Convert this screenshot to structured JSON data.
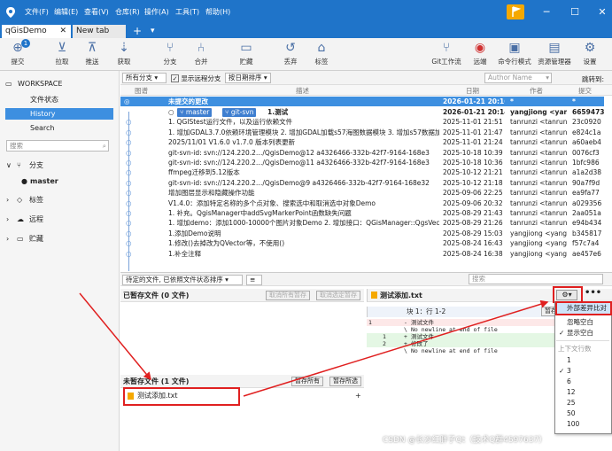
{
  "app": {
    "menus": [
      "文件(F)",
      "编辑(E)",
      "查看(V)",
      "仓库(R)",
      "操作(A)",
      "工具(T)",
      "帮助(H)"
    ],
    "tabs": [
      "qGisDemo",
      "New tab"
    ]
  },
  "toolbar": {
    "items": [
      "提交",
      "拉取",
      "推送",
      "获取",
      "分支",
      "合并",
      "贮藏",
      "丢弃",
      "标签",
      "Git工作流",
      "远端",
      "命令行模式",
      "资源管理器",
      "设置"
    ],
    "commit_badge": "1"
  },
  "sidebar": {
    "workspace": "WORKSPACE",
    "file_status": "文件状态",
    "history": "History",
    "search": "Search",
    "search_placeholder": "搜索",
    "branches": "分支",
    "master": "master",
    "tags": "标签",
    "remotes": "远程",
    "stashes": "贮藏"
  },
  "filterbar": {
    "branch_filter": "所有分支",
    "show_remote": "显示远程分支",
    "sort": "按日期排序",
    "author_placeholder": "Author Name",
    "jump_label": "跳转到:"
  },
  "columns": [
    "图谱",
    "描述",
    "日期",
    "作者",
    "提交"
  ],
  "commits": [
    {
      "desc": "未提交的更改",
      "date": "2026-01-21 20:16",
      "author": "*",
      "hash": "*"
    },
    {
      "tags": [
        "master",
        "git-svn"
      ],
      "desc": "1.测试",
      "date": "2026-01-21 20:14",
      "author": "yangjiong <yang",
      "hash": "6659473"
    },
    {
      "desc": "1. QGIStest运行文件，以及运行依赖文件",
      "date": "2025-11-01 21:51",
      "author": "tanrunzi <tanrun",
      "hash": "23c0920"
    },
    {
      "desc": "1. 增加GDAL3.7.0依赖环境管理模块 2. 增加GDAL加载s57海图数据模块 3. 增加s57数据加",
      "date": "2025-11-01 21:47",
      "author": "tanrunzi <tanrun",
      "hash": "e824c1a"
    },
    {
      "desc": "2025/11/01 V1.6.0 v1.7.0 版本列表更新",
      "date": "2025-11-01 21:24",
      "author": "tanrunzi <tanrun",
      "hash": "a60aeb4"
    },
    {
      "desc": "git-svn-id: svn://124.220.2…/QgisDemo@12 a4326466-332b-42f7-9164-168e3",
      "date": "2025-10-18 10:39",
      "author": "tanrunzi <tanrun",
      "hash": "0076cf3"
    },
    {
      "desc": "git-svn-id: svn://124.220.2…/QgisDemo@11 a4326466-332b-42f7-9164-168e3",
      "date": "2025-10-18 10:36",
      "author": "tanrunzi <tanrun",
      "hash": "1bfc986"
    },
    {
      "desc": "ffmpeg迁移到5.12版本",
      "date": "2025-10-12 21:21",
      "author": "tanrunzi <tanrun",
      "hash": "a1a2d38"
    },
    {
      "desc": "git-svn-id: svn://124.220.2…/QgisDemo@9 a4326466-332b-42f7-9164-168e32",
      "date": "2025-10-12 21:18",
      "author": "tanrunzi <tanrun",
      "hash": "90a7f9d"
    },
    {
      "desc": "增加图层显示和隐藏操作功能",
      "date": "2025-09-06 22:25",
      "author": "tanrunzi <tanrun",
      "hash": "ea9fa77"
    },
    {
      "desc": "V1.4.0：添加特定名称的多个点对象、搜索选中和取消选中对象Demo",
      "date": "2025-09-06 20:32",
      "author": "tanrunzi <tanrun",
      "hash": "a029356"
    },
    {
      "desc": "1. 补充。QgisManager中addSvgMarkerPoint函数缺失问题",
      "date": "2025-08-29 21:43",
      "author": "tanrunzi <tanrun",
      "hash": "2aa051a"
    },
    {
      "desc": "1. 增加demo：添加1000-10000个图片对象Demo 2. 增加接口：QGisManager::QgsVec",
      "date": "2025-08-29 21:26",
      "author": "tanrunzi <tanrun",
      "hash": "e94b434"
    },
    {
      "desc": "1.添加Demo说明",
      "date": "2025-08-29 15:03",
      "author": "yangjiong <yang",
      "hash": "b345817"
    },
    {
      "desc": "1.修改()去掉改为QVector等，不使用()",
      "date": "2025-08-24 16:43",
      "author": "yangjiong <yang",
      "hash": "f57c7a4"
    },
    {
      "desc": "1.补全注释",
      "date": "2025-08-24 16:38",
      "author": "yangjiong <yang",
      "hash": "ae457e6"
    }
  ],
  "lower": {
    "file_sort": "待定的文件, 已依照文件状态排序",
    "search_placeholder": "搜索",
    "staged_title": "已暂存文件 (0 文件)",
    "unstage_all": "取消所有暂存",
    "unstage_selected": "取消选定暂存",
    "unstaged_title": "未暂存文件 (1 文件)",
    "stage_all": "暂存所有",
    "stage_selected": "暂存所选",
    "unstaged_file": "测试添加.txt",
    "diff_file": "测试添加.txt",
    "hunk_label": "块 1：行 1-2",
    "hunk_button": "暂存",
    "diff_lines": [
      {
        "old": "1",
        "new": "",
        "sign": "-",
        "text": "测试文件"
      },
      {
        "old": "",
        "new": "",
        "sign": "\\",
        "text": "No newline at end of file"
      },
      {
        "old": "",
        "new": "1",
        "sign": "+",
        "text": "测试文件"
      },
      {
        "old": "",
        "new": "2",
        "sign": "+",
        "text": "修改了"
      },
      {
        "old": "",
        "new": "",
        "sign": "\\",
        "text": "No newline at end of file"
      }
    ]
  },
  "dropdown": {
    "external_diff": "外部差异比对",
    "ignore_whitespace": "忽略空白",
    "show_whitespace": "显示空白",
    "context_header": "上下文行数",
    "context_options": [
      "1",
      "3",
      "6",
      "12",
      "25",
      "50",
      "100"
    ]
  },
  "watermark": "CSDN @长沙红胖子Qt（技术Q群4597637）",
  "colors": {
    "accent": "#1f74c9",
    "selection": "#3d8fe0",
    "red": "#e02020"
  }
}
